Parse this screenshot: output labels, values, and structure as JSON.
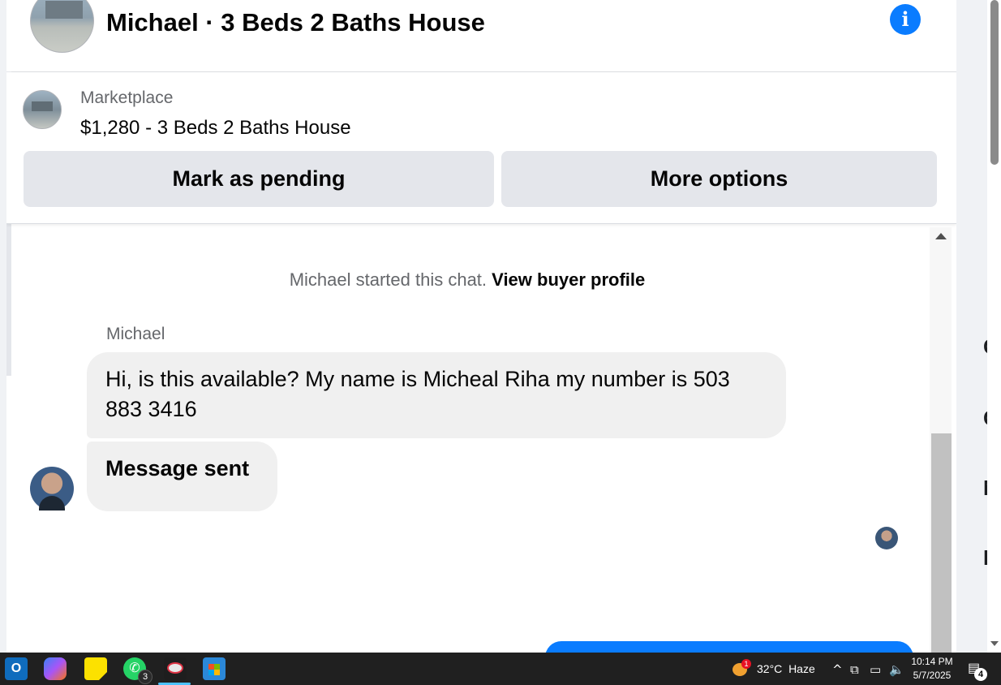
{
  "header": {
    "title": "Michael · 3 Beds 2 Baths House",
    "info_icon": "i"
  },
  "listing": {
    "source": "Marketplace",
    "title": "$1,280 - 3 Beds 2 Baths House",
    "mark_pending_label": "Mark as pending",
    "more_options_label": "More options"
  },
  "conversation": {
    "started_text": "Michael started this chat.",
    "view_profile_label": "View buyer profile",
    "sender_name": "Michael",
    "messages": [
      {
        "text": "Hi, is this available? My name is Micheal Riha my number is 503 883 3416"
      },
      {
        "text": "Message sent"
      }
    ]
  },
  "right_panel_letters": [
    "C",
    "C",
    "N",
    "F"
  ],
  "taskbar": {
    "apps": [
      {
        "name": "Outlook",
        "icon": "outlook-icon",
        "glyph": "O"
      },
      {
        "name": "Copilot",
        "icon": "copilot-icon"
      },
      {
        "name": "Sticky Notes",
        "icon": "sticky-notes-icon"
      },
      {
        "name": "WhatsApp",
        "icon": "whatsapp-icon",
        "glyph": "✆",
        "badge": "3"
      },
      {
        "name": "Snipping Tool",
        "icon": "snipping-tool-icon"
      },
      {
        "name": "Microsoft Store",
        "icon": "store-icon"
      }
    ],
    "weather": {
      "badge": "1",
      "temp": "32°C",
      "condition": "Haze"
    },
    "tray_icons": {
      "chevron": "^",
      "meet": "⧉",
      "network": "▭",
      "volume": "🔈"
    },
    "time": "10:14 PM",
    "date": "5/7/2025",
    "notifications_badge": "4"
  },
  "colors": {
    "accent": "#0a7cff",
    "button_bg": "#e4e6eb",
    "bubble_bg": "#f0f0f0",
    "taskbar_bg": "#202020"
  }
}
